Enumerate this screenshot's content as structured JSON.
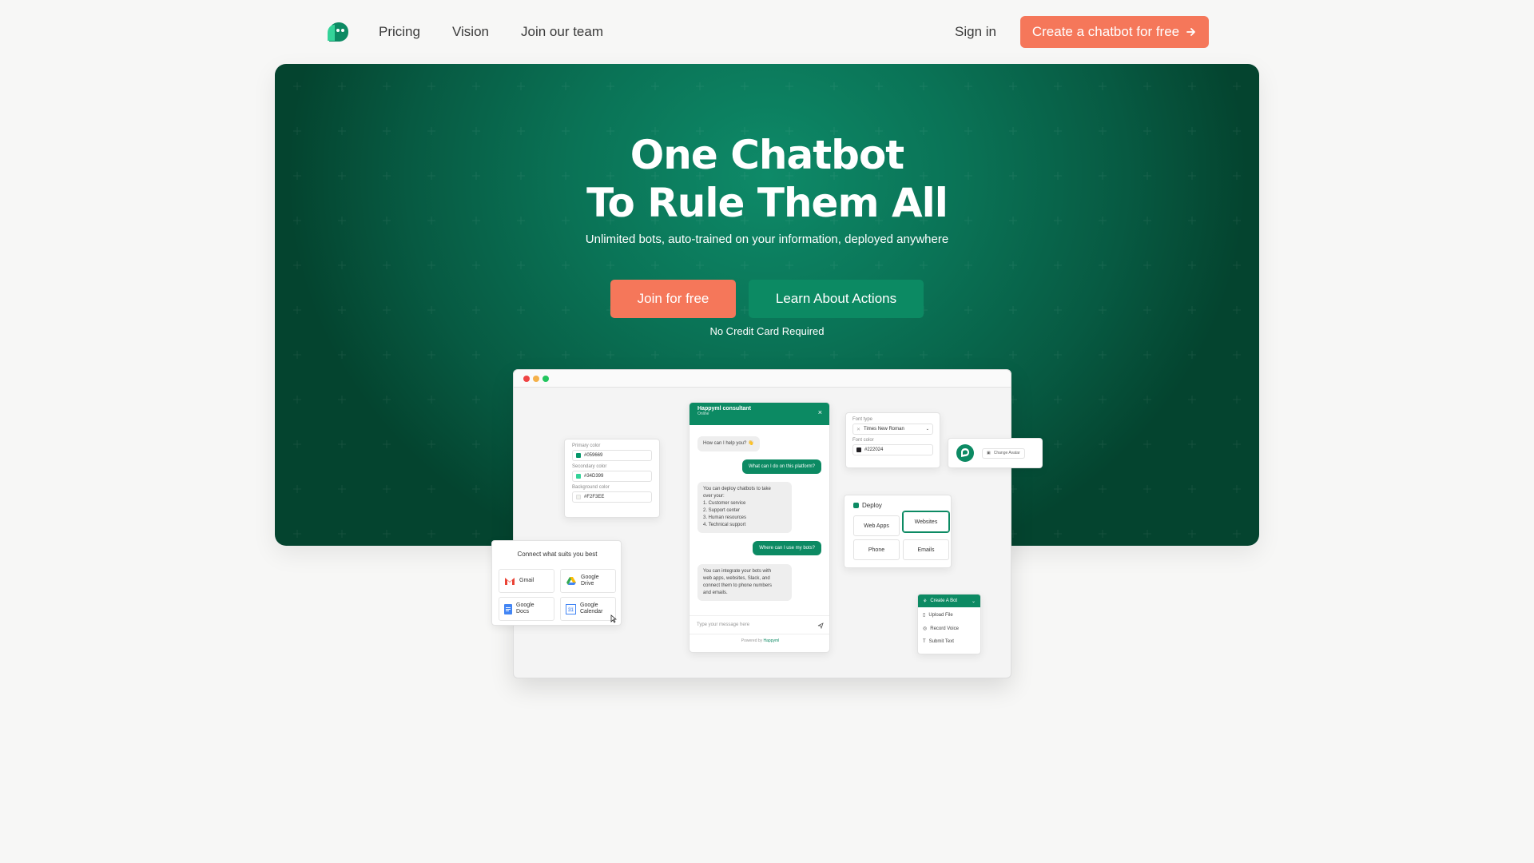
{
  "nav": {
    "links": [
      "Pricing",
      "Vision",
      "Join our team"
    ],
    "sign_in": "Sign in",
    "cta": "Create a chatbot for free",
    "cta_icon": "arrow-right-icon"
  },
  "hero": {
    "title_line1": "One Chatbot",
    "title_line2": "To Rule Them All",
    "subtitle": "Unlimited bots, auto-trained on your information, deployed anywhere",
    "join_button": "Join for free",
    "learn_button": "Learn About Actions",
    "note": "No Credit Card Required"
  },
  "mock": {
    "colors": {
      "primary_label": "Primary color",
      "primary_value": "#059669",
      "primary_hex": "#059669",
      "secondary_label": "Secondary color",
      "secondary_value": "#34D399",
      "secondary_hex": "#34D399",
      "background_label": "Background color",
      "background_value": "#F2F3EE",
      "background_hex": "#F2F3EE"
    },
    "chat": {
      "title": "Happyml consultant",
      "status": "Online",
      "messages": [
        {
          "from": "bot",
          "text": "How can I help you? 👋"
        },
        {
          "from": "user",
          "text": "What can I do on this platform?"
        },
        {
          "from": "bot",
          "lines": [
            "You can deploy chatbots to take",
            "over your:",
            "1. Customer service",
            "2. Support center",
            "3. Human resources",
            "4. Technical support"
          ]
        },
        {
          "from": "user",
          "text": "Where can I use my bots?"
        },
        {
          "from": "bot",
          "lines": [
            "You can integrate your bots with",
            "web apps, websites, Slack, and",
            "connect them to phone numbers",
            "and emails."
          ]
        }
      ],
      "input_placeholder": "Type your message here",
      "powered_by": "Powered by",
      "brand": "Happyml"
    },
    "font": {
      "font_label": "Font type",
      "font_value": "Times New Roman",
      "color_label": "Font color",
      "color_value": "#222024"
    },
    "avatar": {
      "change_label": "Change Avatar"
    },
    "deploy": {
      "title": "Deploy",
      "options": [
        "Web Apps",
        "Websites",
        "Phone",
        "Emails"
      ]
    },
    "connect": {
      "title": "Connect what suits you best",
      "items": [
        {
          "icon": "gmail-icon",
          "label": "Gmail"
        },
        {
          "icon": "google-drive-icon",
          "label": "Google\nDrive"
        },
        {
          "icon": "google-docs-icon",
          "label": "Google\nDocs"
        },
        {
          "icon": "google-calendar-icon",
          "label": "Google\nCalendar"
        }
      ],
      "labels": [
        "Gmail",
        "Google",
        "Drive",
        "Google",
        "Docs",
        "Google",
        "Calendar"
      ]
    },
    "create_bot": {
      "title": "Create A Bot",
      "items": [
        "Upload File",
        "Record Voice",
        "Submit Text"
      ]
    }
  }
}
